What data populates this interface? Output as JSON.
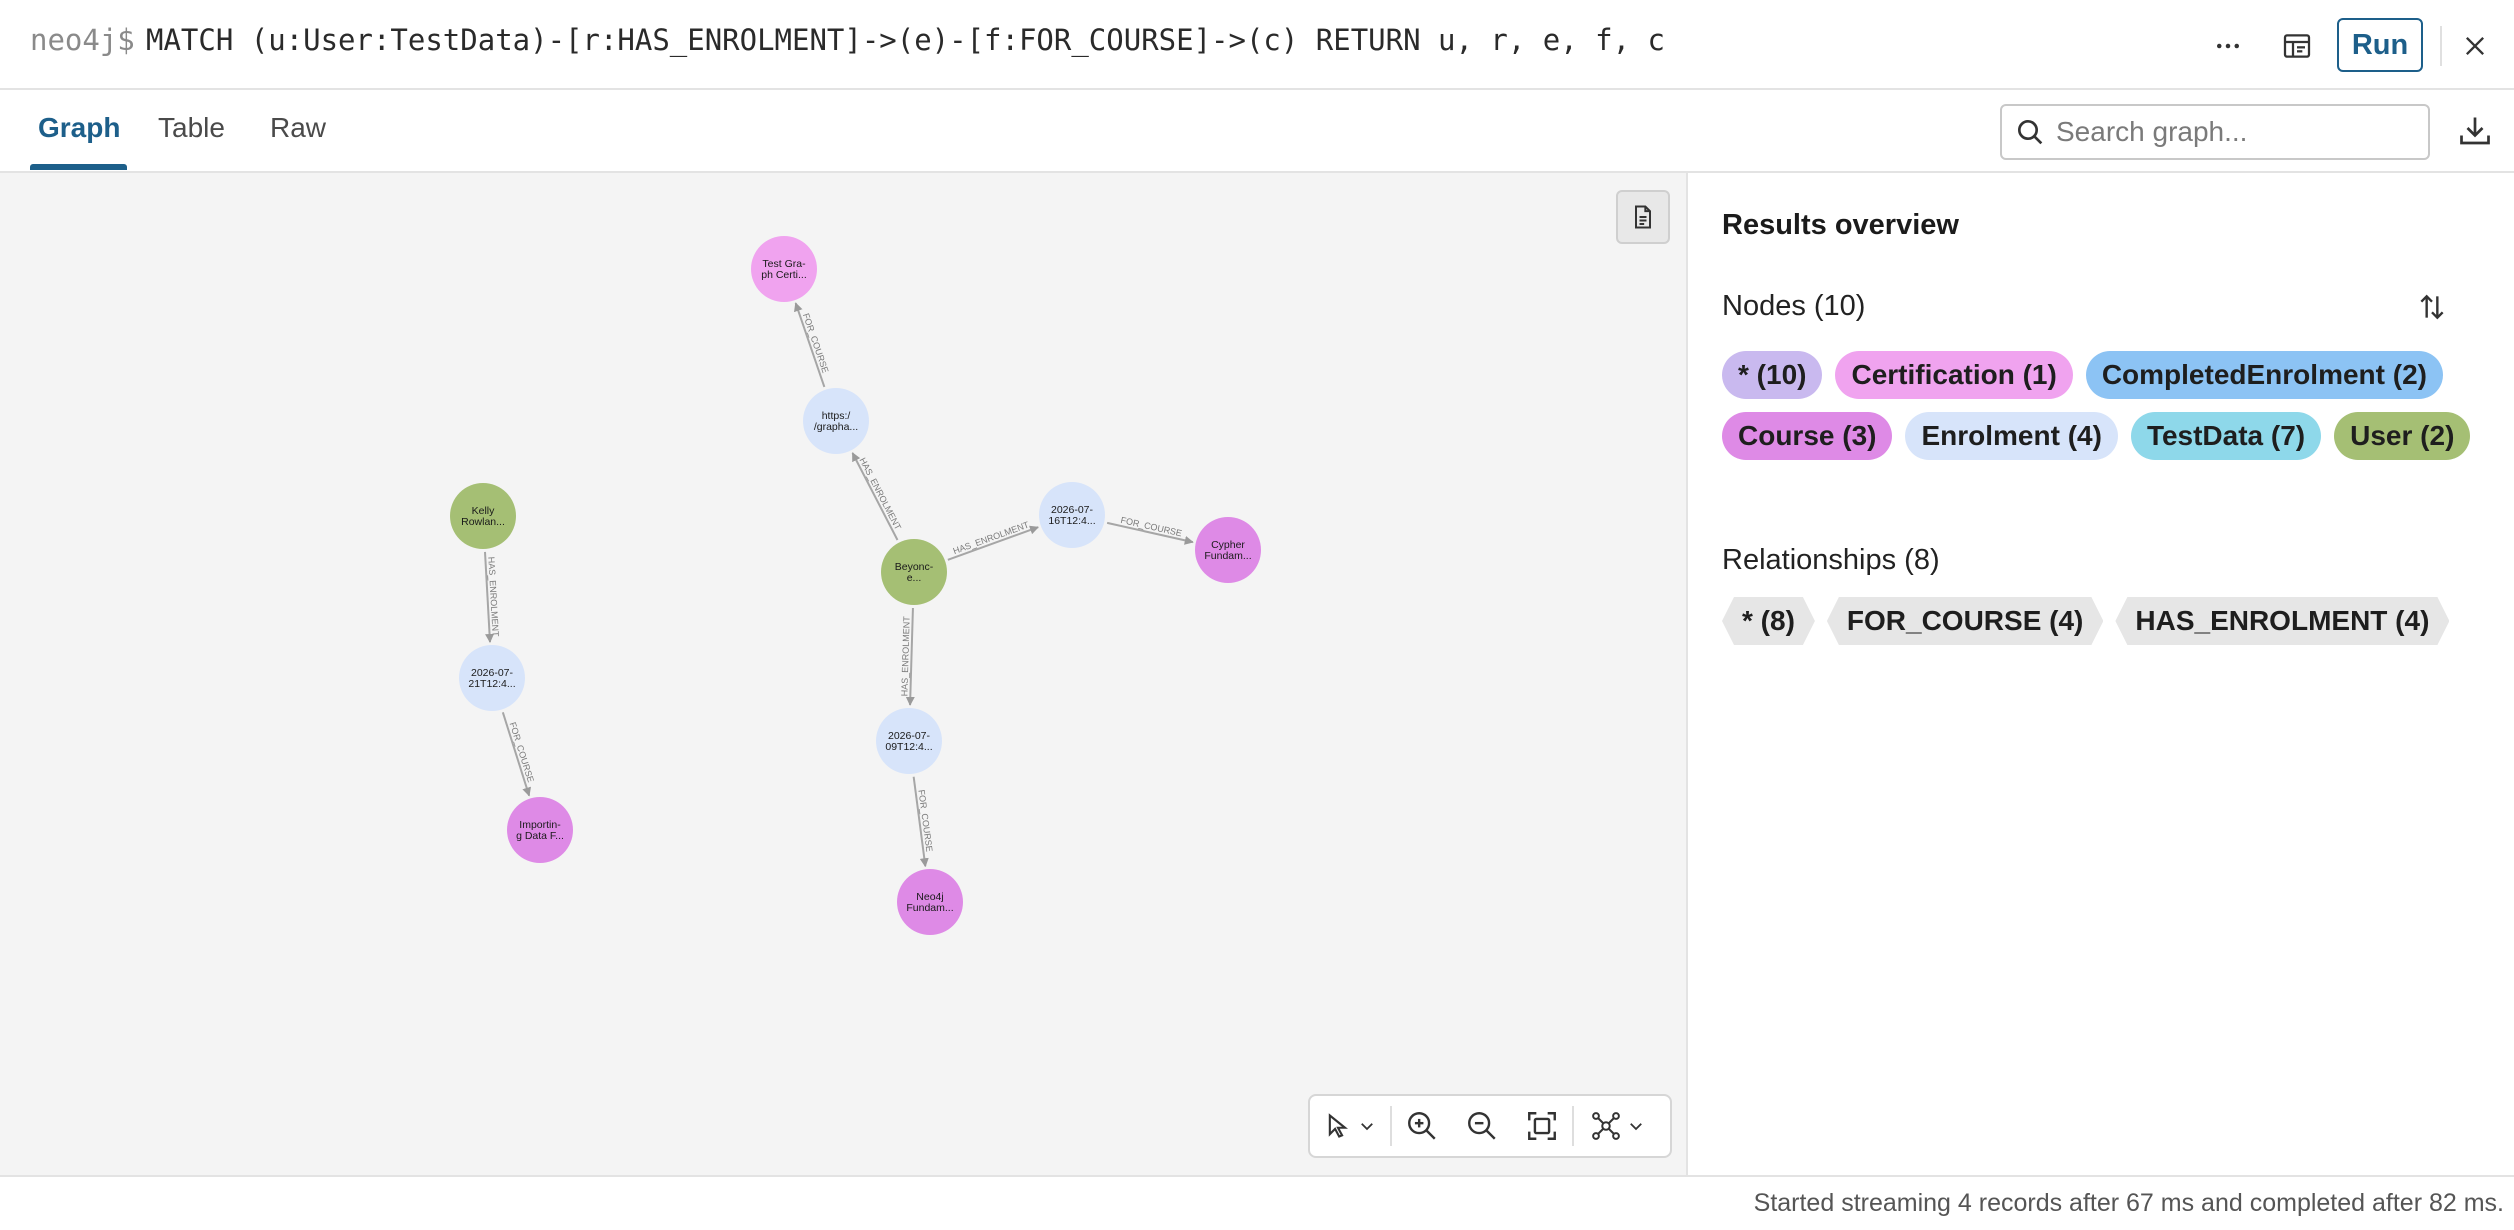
{
  "query": {
    "prompt": "neo4j$",
    "text": "MATCH (u:User:TestData)-[r:HAS_ENROLMENT]->(e)-[f:FOR_COURSE]->(c) RETURN u, r, e, f, c",
    "run_label": "Run",
    "more_icon": "more-horizontal-icon",
    "favorite_icon": "save-favorite-icon",
    "close_icon": "close-icon"
  },
  "tabs": [
    {
      "label": "Graph",
      "active": true
    },
    {
      "label": "Table",
      "active": false
    },
    {
      "label": "Raw",
      "active": false
    }
  ],
  "search": {
    "placeholder": "Search graph...",
    "value": ""
  },
  "graph": {
    "node_colors": {
      "User": "#a5bf74",
      "Enrolment": "#d7e4fa",
      "Course": "#de8ae6",
      "Certification": "#f0a3ef"
    },
    "nodes": [
      {
        "id": "cert",
        "type": "Certification",
        "lines": [
          "Test Gra-",
          "ph Certi..."
        ]
      },
      {
        "id": "enr_url",
        "type": "Enrolment",
        "lines": [
          "https:/",
          "/grapha..."
        ]
      },
      {
        "id": "kelly",
        "type": "User",
        "lines": [
          "Kelly",
          "Rowlan..."
        ]
      },
      {
        "id": "beyonce",
        "type": "User",
        "lines": [
          "Beyonc-",
          "e..."
        ]
      },
      {
        "id": "enr_16",
        "type": "Enrolment",
        "lines": [
          "2026-07-",
          "16T12:4..."
        ]
      },
      {
        "id": "cypher",
        "type": "Course",
        "lines": [
          "Cypher",
          "Fundam..."
        ]
      },
      {
        "id": "enr_21",
        "type": "Enrolment",
        "lines": [
          "2026-07-",
          "21T12:4..."
        ]
      },
      {
        "id": "enr_09",
        "type": "Enrolment",
        "lines": [
          "2026-07-",
          "09T12:4..."
        ]
      },
      {
        "id": "importing",
        "type": "Course",
        "lines": [
          "Importin-",
          "g Data F..."
        ]
      },
      {
        "id": "neo4j",
        "type": "Course",
        "lines": [
          "Neo4j",
          "Fundam..."
        ]
      }
    ],
    "relationships": [
      {
        "from": "enr_url",
        "to": "cert",
        "label": "FOR_COURSE"
      },
      {
        "from": "beyonce",
        "to": "enr_url",
        "label": "HAS_ENROLMENT"
      },
      {
        "from": "beyonce",
        "to": "enr_16",
        "label": "HAS_ENROLMENT"
      },
      {
        "from": "enr_16",
        "to": "cypher",
        "label": "FOR_COURSE"
      },
      {
        "from": "beyonce",
        "to": "enr_09",
        "label": "HAS_ENROLMENT"
      },
      {
        "from": "enr_09",
        "to": "neo4j",
        "label": "FOR_COURSE"
      },
      {
        "from": "kelly",
        "to": "enr_21",
        "label": "HAS_ENROLMENT"
      },
      {
        "from": "enr_21",
        "to": "importing",
        "label": "FOR_COURSE"
      }
    ]
  },
  "toolbar": {
    "select_icon": "pointer-select-icon",
    "zoom_in_icon": "zoom-in-icon",
    "zoom_out_icon": "zoom-out-icon",
    "fit_icon": "fit-to-screen-icon",
    "layout_icon": "graph-layout-icon"
  },
  "results": {
    "title": "Results overview",
    "nodes_header": "Nodes (10)",
    "node_labels": [
      {
        "text": "* (10)",
        "color": "#c9b9ef"
      },
      {
        "text": "Certification (1)",
        "color": "#f0a3ef"
      },
      {
        "text": "CompletedEnrolment (2)",
        "color": "#8cc3f4"
      },
      {
        "text": "Course (3)",
        "color": "#de8ae6"
      },
      {
        "text": "Enrolment (4)",
        "color": "#d7e4fa"
      },
      {
        "text": "TestData (7)",
        "color": "#8ed8ea"
      },
      {
        "text": "User (2)",
        "color": "#a5bf74"
      }
    ],
    "relationships_header": "Relationships (8)",
    "relationship_types": [
      {
        "text": "* (8)"
      },
      {
        "text": "FOR_COURSE (4)"
      },
      {
        "text": "HAS_ENROLMENT (4)"
      }
    ]
  },
  "status": "Started streaming 4 records after 67 ms and completed after 82 ms."
}
